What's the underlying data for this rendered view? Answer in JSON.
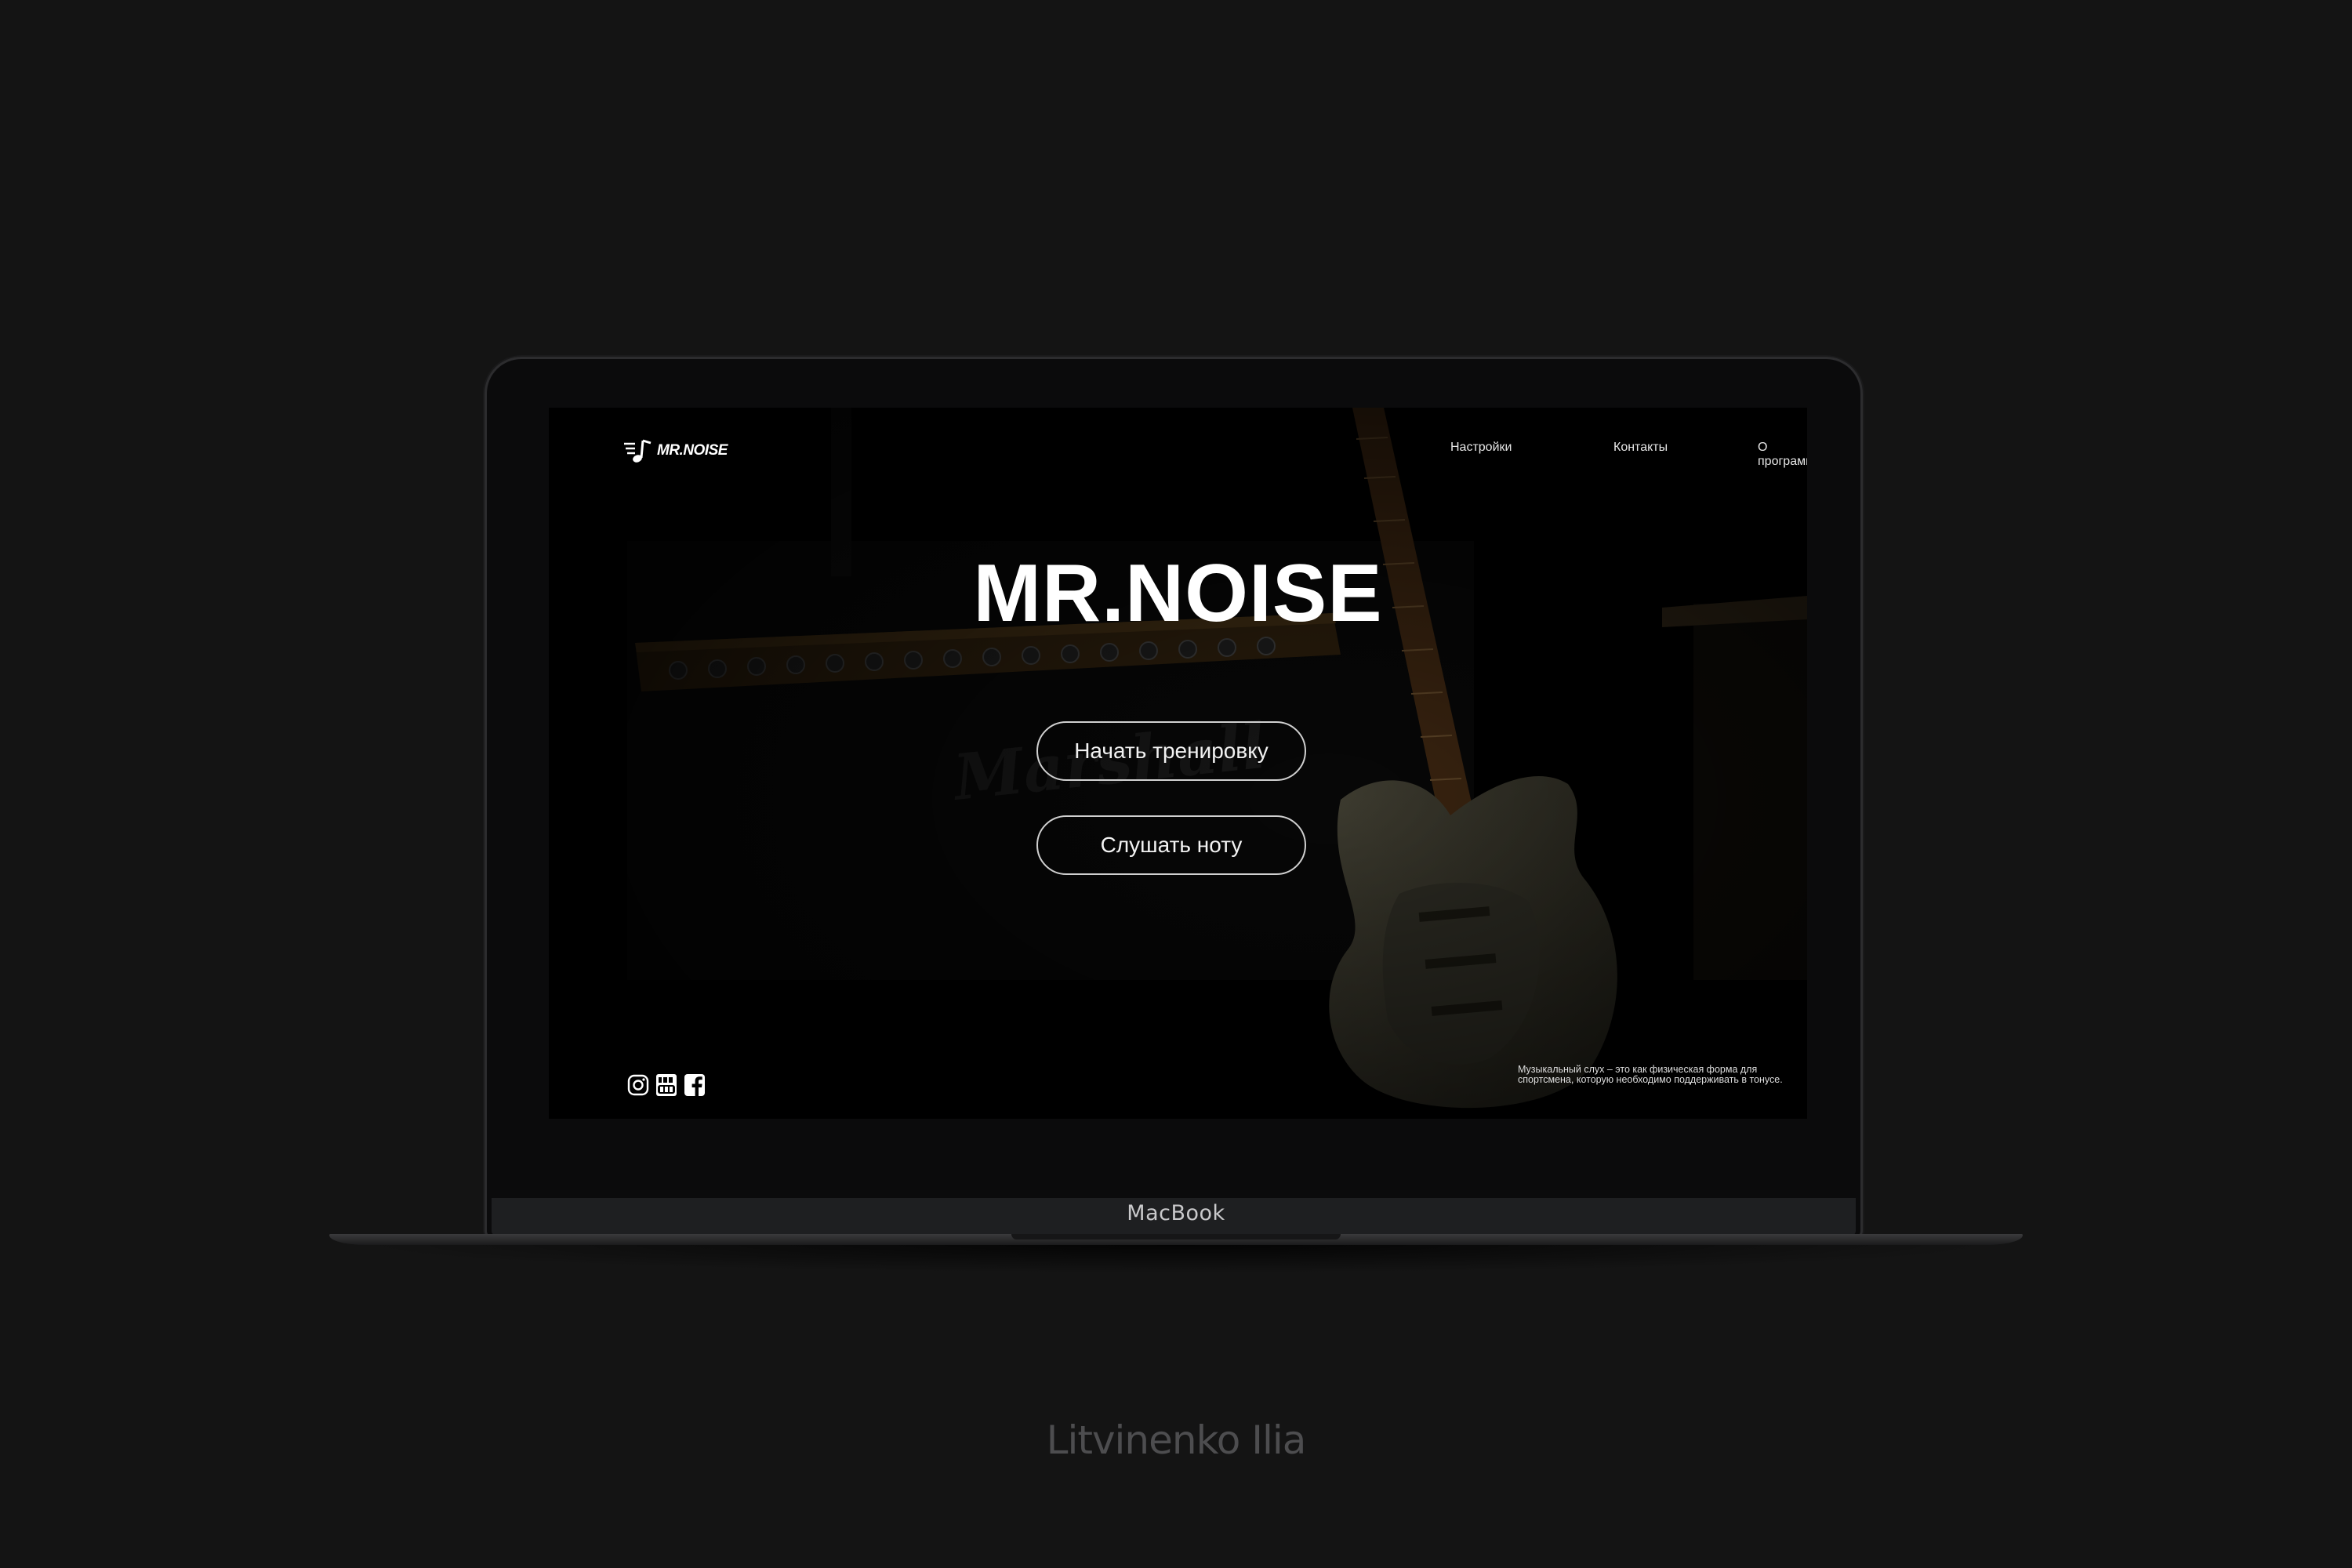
{
  "site": {
    "logo_text": "MR.NOISE",
    "nav": [
      {
        "label": "Настройки"
      },
      {
        "label": "Контакты"
      },
      {
        "label": "О программе"
      }
    ],
    "hero_title": "MR.NOISE",
    "buttons": {
      "start_training": "Начать тренировку",
      "listen_note": "Слушать ноту"
    },
    "socials": [
      {
        "icon": "instagram-icon"
      },
      {
        "icon": "youtube-icon"
      },
      {
        "icon": "facebook-icon"
      }
    ],
    "tagline": "Музыкальный слух – это как физическая форма для спортсмена, которую необходимо поддерживать в тонусе."
  },
  "device": {
    "chin_label": "MacBook"
  },
  "author": "Litvinenko Ilia",
  "colors": {
    "page_background": "#141414",
    "screen_background": "#000000",
    "text": "#ffffff",
    "button_border": "#d0d0d0"
  }
}
